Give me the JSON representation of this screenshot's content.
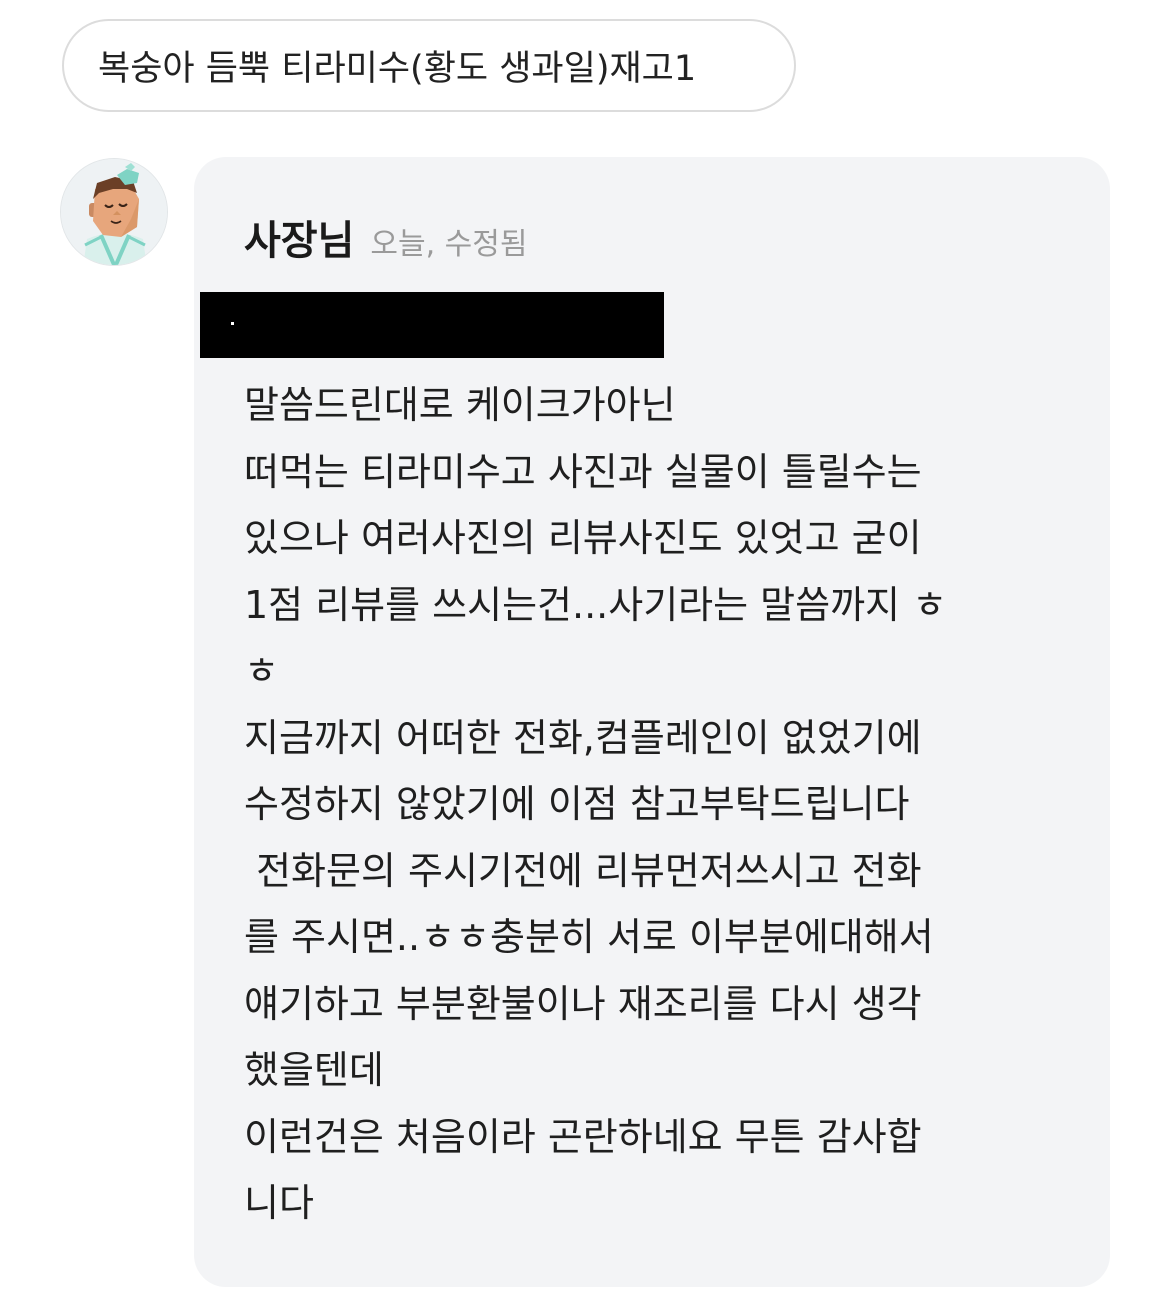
{
  "menu_chip": {
    "label": "복숭아 듬뿍 티라미수(황도 생과일)재고1"
  },
  "reply": {
    "author": "사장님",
    "meta": "오늘, 수정됨",
    "redacted_line": "·",
    "lines": [
      "말씀드린대로 케이크가아닌",
      "떠먹는 티라미수고 사진과 실물이 틀릴수는",
      "있으나 여러사진의 리뷰사진도 있엇고 굳이",
      "1점 리뷰를 쓰시는건...사기라는 말씀까지 ㅎ",
      "ㅎ",
      "지금까지 어떠한 전화,컴플레인이 없었기에",
      "수정하지 않았기에 이점 참고부탁드립니다",
      " 전화문의 주시기전에 리뷰먼저쓰시고 전화",
      "를 주시면..ㅎㅎ충분히 서로 이부분에대해서",
      "얘기하고 부분환불이나 재조리를 다시 생각",
      "했을텐데",
      "이런건은 처음이라 곤란하네요 무튼 감사합",
      "니다"
    ]
  },
  "avatar": {
    "icon": "chef-avatar-icon"
  },
  "colors": {
    "bubble_background": "#f3f4f6",
    "meta_text": "#9a9a9a",
    "chip_border": "#dcdcdc",
    "redaction": "#000000",
    "avatar_accent": "#7fd3c4"
  }
}
